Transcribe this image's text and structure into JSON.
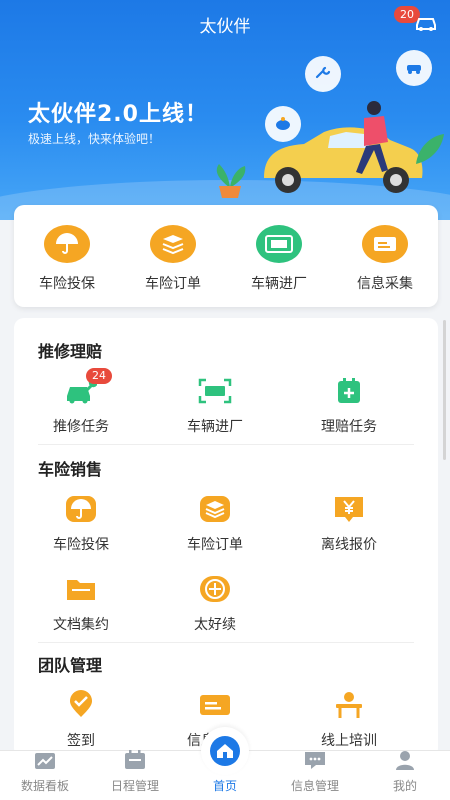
{
  "header": {
    "title": "太伙伴",
    "notification_count": "20"
  },
  "banner": {
    "title": "太伙伴2.0上线！",
    "subtitle": "极速上线，快来体验吧！"
  },
  "quick": [
    {
      "label": "车险投保",
      "icon": "umbrella-icon",
      "color": "#f5a623"
    },
    {
      "label": "车险订单",
      "icon": "stack-icon",
      "color": "#f5a623"
    },
    {
      "label": "车辆进厂",
      "icon": "ocr-icon",
      "color": "#2ec27e"
    },
    {
      "label": "信息采集",
      "icon": "card-icon",
      "color": "#f5a623"
    }
  ],
  "sections": {
    "repair": {
      "title": "推修理赔",
      "items": [
        {
          "label": "推修任务",
          "icon": "car-wrench-icon",
          "badge": "24"
        },
        {
          "label": "车辆进厂",
          "icon": "ocr-icon"
        },
        {
          "label": "理赔任务",
          "icon": "calendar-plus-icon"
        }
      ]
    },
    "sales": {
      "title": "车险销售",
      "items": [
        {
          "label": "车险投保",
          "icon": "umbrella-icon"
        },
        {
          "label": "车险订单",
          "icon": "stack-icon"
        },
        {
          "label": "离线报价",
          "icon": "yen-icon"
        },
        {
          "label": "文档集约",
          "icon": "folder-icon"
        },
        {
          "label": "太好续",
          "icon": "renew-icon"
        }
      ]
    },
    "team": {
      "title": "团队管理",
      "items": [
        {
          "label": "签到",
          "icon": "check-pin-icon"
        },
        {
          "label": "信息采集",
          "icon": "card-icon"
        },
        {
          "label": "线上培训",
          "icon": "training-icon"
        }
      ]
    }
  },
  "nav": [
    {
      "label": "数据看板",
      "icon": "chart-icon"
    },
    {
      "label": "日程管理",
      "icon": "calendar-icon"
    },
    {
      "label": "首页",
      "icon": "home-icon",
      "active": true
    },
    {
      "label": "信息管理",
      "icon": "message-icon"
    },
    {
      "label": "我的",
      "icon": "user-icon"
    }
  ],
  "colors": {
    "primary": "#1d79e6",
    "accent_orange": "#f5a623",
    "accent_green": "#2ec27e",
    "badge_red": "#e84a3c"
  }
}
